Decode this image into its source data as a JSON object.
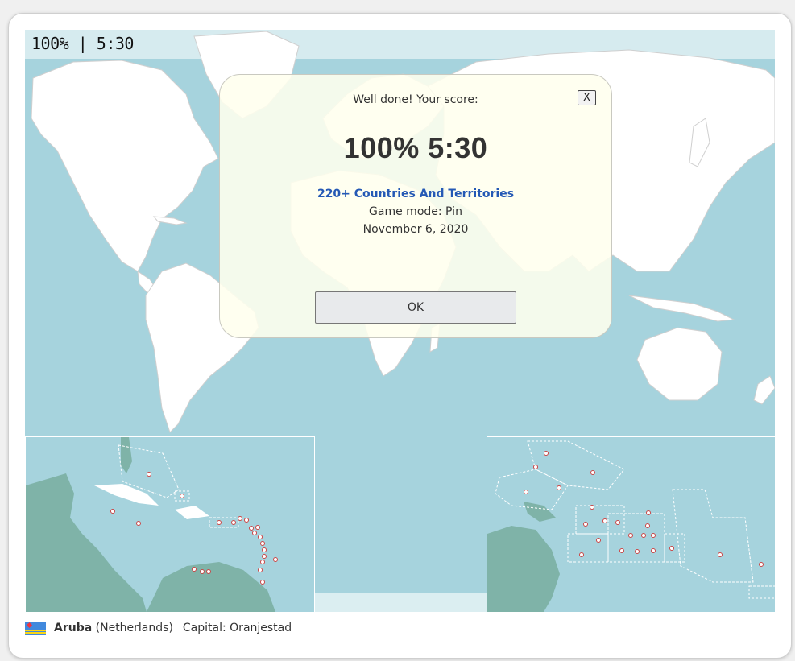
{
  "status": {
    "text": "100% | 5:30"
  },
  "modal": {
    "subtitle": "Well done! Your score:",
    "close_label": "X",
    "score_text": "100% 5:30",
    "quiz_title": "220+ Countries And Territories",
    "game_mode": "Game mode: Pin",
    "date": "November 6, 2020",
    "ok_label": "OK"
  },
  "footer": {
    "country": "Aruba",
    "sovereign": "(Netherlands)",
    "capital": "Capital: Oranjestad",
    "flag_icon": "aruba-flag-icon"
  },
  "colors": {
    "ocean": "#a6d3dd",
    "land": "#ffffff",
    "inset_land": "#7fb3a8",
    "modal_bg": "#ffffee",
    "link": "#2559b5"
  }
}
